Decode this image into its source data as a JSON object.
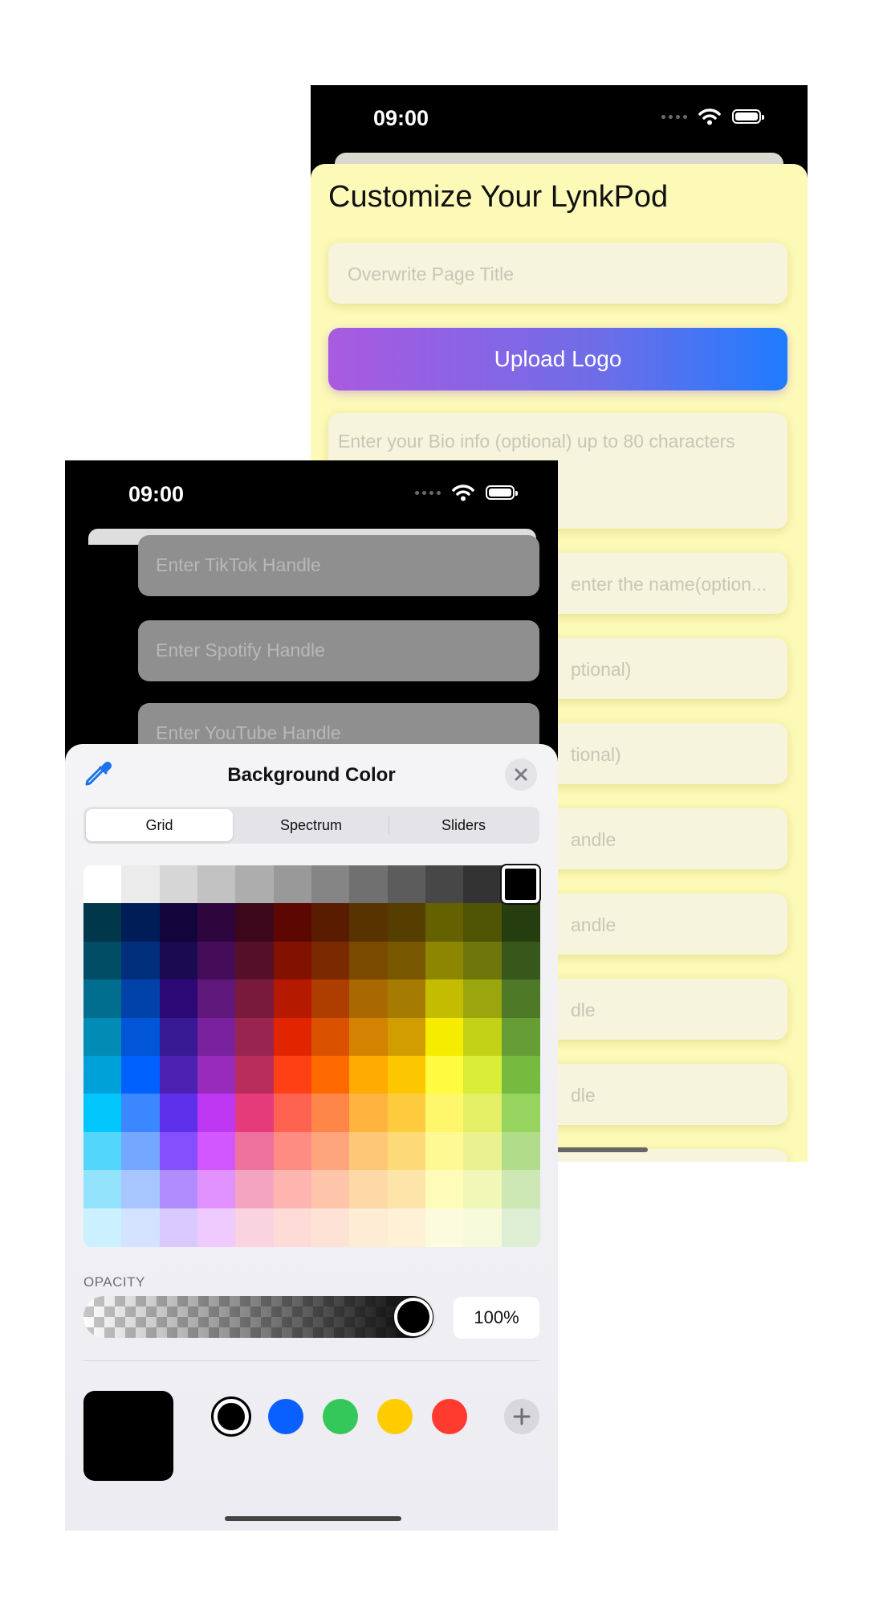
{
  "back_screen": {
    "status_time": "09:00",
    "title": "Customize Your LynkPod",
    "page_title_placeholder": "Overwrite Page Title",
    "upload_logo_label": "Upload Logo",
    "bio_placeholder": "Enter your Bio info (optional) up to 80 characters",
    "partial_fields": [
      "enter the name(option...",
      "ptional)",
      "tional)",
      "andle",
      "andle",
      "dle",
      "dle"
    ]
  },
  "front_screen": {
    "status_time": "09:00",
    "fields": [
      "Enter TikTok Handle",
      "Enter Spotify Handle",
      "Enter YouTube Handle"
    ],
    "picker": {
      "title": "Background Color",
      "tabs": [
        "Grid",
        "Spectrum",
        "Sliders"
      ],
      "active_tab": "Grid",
      "opacity_label": "OPACITY",
      "opacity_value": "100%",
      "opacity_fraction": 1.0,
      "current_color": "#000000",
      "swatches": [
        "#000000",
        "#0a60ff",
        "#34c759",
        "#ffcc00",
        "#ff3b30"
      ],
      "selected_swatch": 0,
      "grid_selected": {
        "row": 0,
        "col": 11
      },
      "grid_colors": [
        [
          "#ffffff",
          "#ebebeb",
          "#d6d6d6",
          "#c2c2c2",
          "#adadad",
          "#999999",
          "#858585",
          "#707070",
          "#5c5c5c",
          "#474747",
          "#333333",
          "#000000"
        ],
        [
          "#00374a",
          "#011d57",
          "#11053b",
          "#2e063d",
          "#3c071b",
          "#5c0701",
          "#5a1c00",
          "#583300",
          "#563d00",
          "#666100",
          "#4f5504",
          "#263e0f"
        ],
        [
          "#004d65",
          "#012f7b",
          "#1a0a52",
          "#450d59",
          "#551029",
          "#831100",
          "#7b2900",
          "#7a4a00",
          "#785800",
          "#8c8602",
          "#6f760a",
          "#38571a"
        ],
        [
          "#016e8f",
          "#0042a9",
          "#2c0977",
          "#61187c",
          "#791a3d",
          "#b51a00",
          "#ad3e00",
          "#a96800",
          "#a67b01",
          "#c4bc00",
          "#9ba50e",
          "#4e7a27"
        ],
        [
          "#008cb4",
          "#0056d6",
          "#371a94",
          "#7a219e",
          "#99244f",
          "#e22400",
          "#da5100",
          "#d38301",
          "#d19d01",
          "#f5ec00",
          "#c3d117",
          "#669d34"
        ],
        [
          "#00a1d8",
          "#0061fe",
          "#4d22b2",
          "#982abc",
          "#b92d5d",
          "#ff4015",
          "#ff6a00",
          "#ffab01",
          "#fdc700",
          "#fefb41",
          "#d9ec37",
          "#76bb40"
        ],
        [
          "#01c7fc",
          "#3a87fe",
          "#5e30eb",
          "#be38f3",
          "#e63b7a",
          "#fe6250",
          "#fe8648",
          "#feb43f",
          "#fecb3e",
          "#fff76b",
          "#e4ef65",
          "#96d35f"
        ],
        [
          "#52d6fc",
          "#74a7ff",
          "#864ffe",
          "#d357fe",
          "#ee719e",
          "#ff8c82",
          "#fea57d",
          "#fec777",
          "#fed977",
          "#fff994",
          "#eaf28f",
          "#b1dd8b"
        ],
        [
          "#93e3fc",
          "#a7c6ff",
          "#b18cfe",
          "#e292fe",
          "#f4a4c0",
          "#ffb5af",
          "#ffc5ab",
          "#fed9a8",
          "#fde4a8",
          "#fffbb9",
          "#f1f7b7",
          "#cde8b5"
        ],
        [
          "#cbf0ff",
          "#d3e2ff",
          "#d9c9fe",
          "#efcaff",
          "#f9d3e0",
          "#ffdbd8",
          "#ffe2d6",
          "#feecd4",
          "#fef1d5",
          "#fdfbdd",
          "#f6fadb",
          "#deeed4"
        ]
      ]
    }
  }
}
